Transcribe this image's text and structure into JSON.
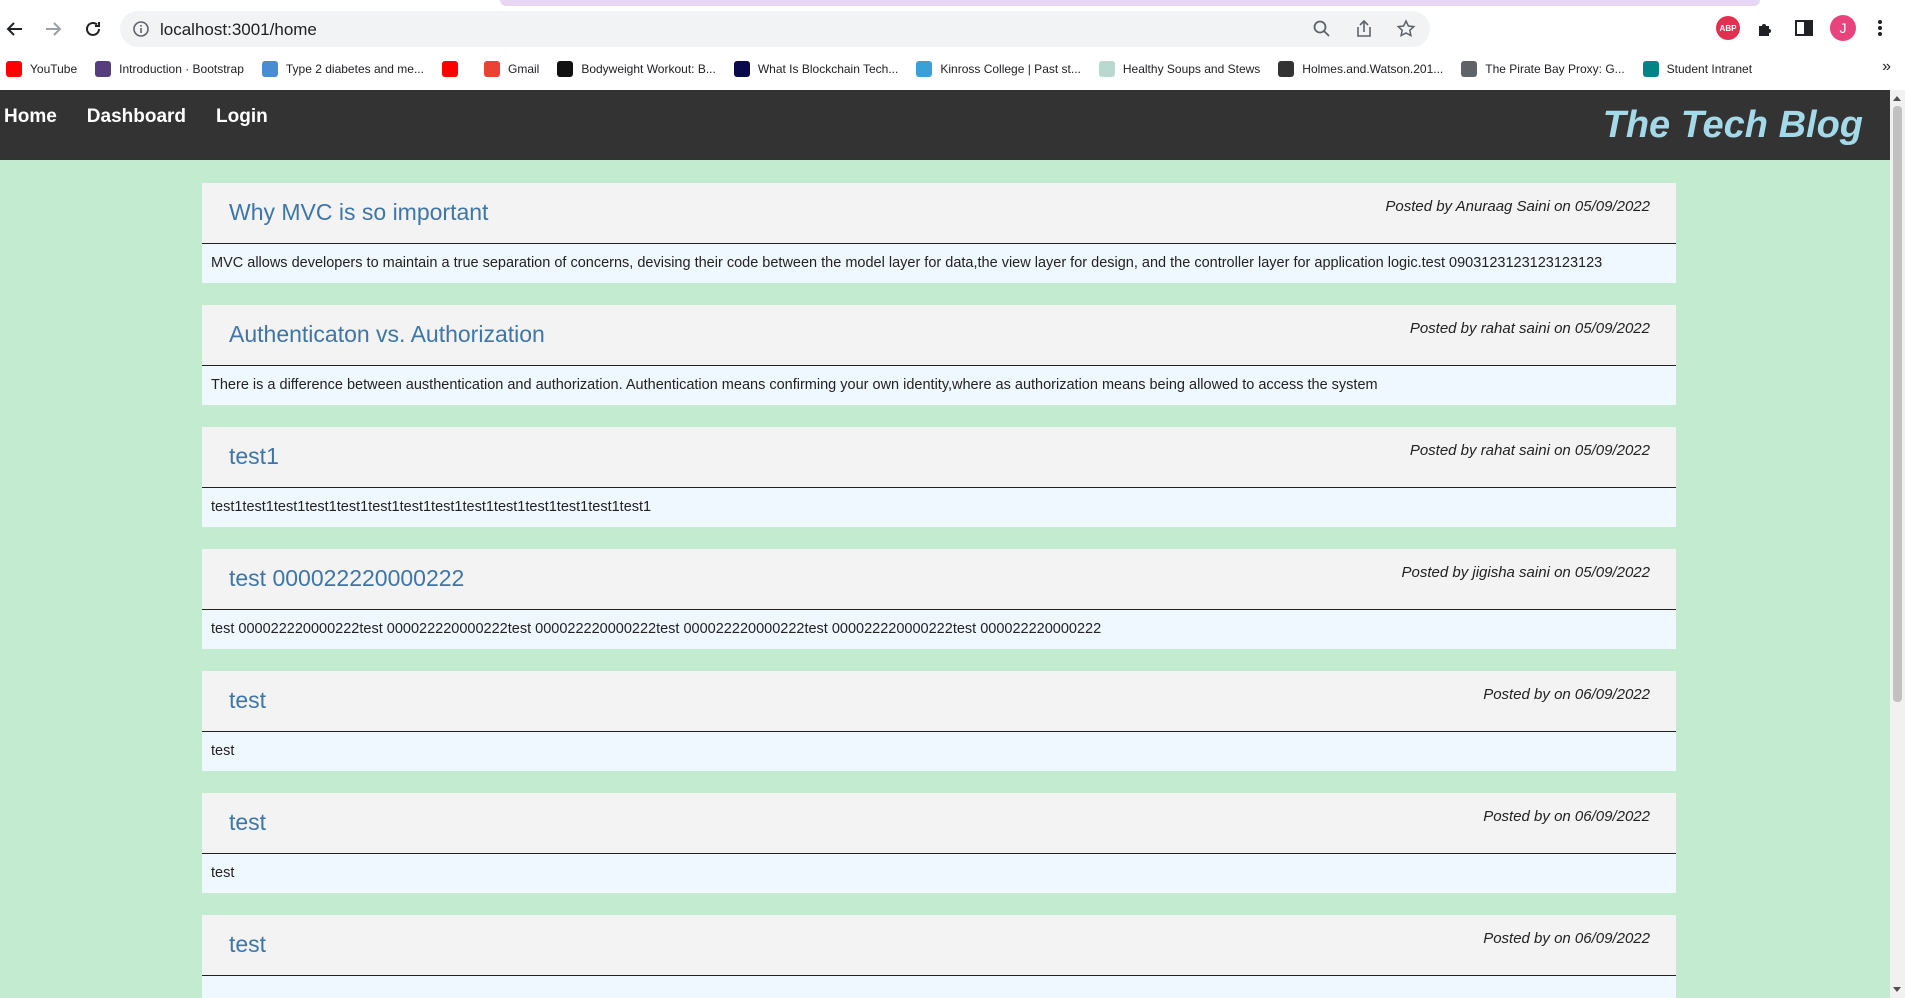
{
  "browser": {
    "url": "localhost:3001/home",
    "avatar_initial": "J",
    "abp_label": "ABP",
    "bookmarks": [
      {
        "label": "YouTube",
        "icon": "youtube-icon",
        "color": "#ff0000"
      },
      {
        "label": "Introduction · Bootstrap",
        "icon": "bootstrap-icon",
        "color": "#563d7c"
      },
      {
        "label": "Type 2 diabetes and me...",
        "icon": "diabetes-icon",
        "color": "#4b8bd4"
      },
      {
        "label": "",
        "icon": "youtube-icon",
        "color": "#ff0000"
      },
      {
        "label": "Gmail",
        "icon": "gmail-icon",
        "color": "#ea4335"
      },
      {
        "label": "Bodyweight Workout: B...",
        "icon": "workout-icon",
        "color": "#111111"
      },
      {
        "label": "What Is Blockchain Tech...",
        "icon": "blockchain-icon",
        "color": "#0a0a4a"
      },
      {
        "label": "Kinross College | Past st...",
        "icon": "college-icon",
        "color": "#3aa0d8"
      },
      {
        "label": "Healthy Soups and Stews",
        "icon": "soup-icon",
        "color": "#b8d8d0"
      },
      {
        "label": "Holmes.and.Watson.201...",
        "icon": "movie-icon",
        "color": "#333333"
      },
      {
        "label": "The Pirate Bay Proxy: G...",
        "icon": "globe-icon",
        "color": "#5f6368"
      },
      {
        "label": "Student Intranet",
        "icon": "sharepoint-icon",
        "color": "#038387"
      }
    ],
    "more_label": "»"
  },
  "site": {
    "nav": [
      {
        "label": "Home"
      },
      {
        "label": "Dashboard"
      },
      {
        "label": "Login"
      }
    ],
    "title": "The Tech Blog"
  },
  "posts": [
    {
      "title": "Why MVC is so important",
      "meta": "Posted by Anuraag Saini on 05/09/2022",
      "body": "MVC allows developers to maintain a true separation of concerns, devising their code between the model layer for data,the view layer for design, and the controller layer for application logic.test 0903123123123123123"
    },
    {
      "title": "Authenticaton vs. Authorization",
      "meta": "Posted by rahat saini on 05/09/2022",
      "body": "There is a difference between austhentication and authorization. Authentication means confirming your own identity,where as authorization means being allowed to access the system"
    },
    {
      "title": "test1",
      "meta": "Posted by rahat saini on 05/09/2022",
      "body": "test1test1test1test1test1test1test1test1test1test1test1test1test1test1"
    },
    {
      "title": "test 000022220000222",
      "meta": "Posted by jigisha saini on 05/09/2022",
      "body": "test 000022220000222test 000022220000222test 000022220000222test 000022220000222test 000022220000222test 000022220000222"
    },
    {
      "title": "test",
      "meta": "Posted by on 06/09/2022",
      "body": "test"
    },
    {
      "title": "test",
      "meta": "Posted by on 06/09/2022",
      "body": "test"
    },
    {
      "title": "test",
      "meta": "Posted by on 06/09/2022",
      "body": ""
    }
  ]
}
